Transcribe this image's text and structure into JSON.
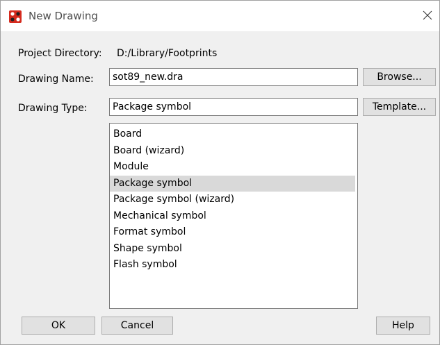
{
  "window": {
    "title": "New Drawing",
    "close_glyph": "✕",
    "icon": "cadence-app-icon"
  },
  "form": {
    "project_directory_label": "Project Directory:",
    "project_directory_value": "D:/Library/Footprints",
    "drawing_name_label": "Drawing Name:",
    "drawing_name_value": "sot89_new.dra",
    "drawing_type_label": "Drawing Type:",
    "drawing_type_value": "Package symbol"
  },
  "buttons": {
    "browse": "Browse...",
    "template": "Template...",
    "ok": "OK",
    "cancel": "Cancel",
    "help": "Help"
  },
  "drawing_types": [
    "Board",
    "Board (wizard)",
    "Module",
    "Package symbol",
    "Package symbol (wizard)",
    "Mechanical symbol",
    "Format symbol",
    "Shape symbol",
    "Flash symbol"
  ],
  "selected_type_index": 3,
  "colors": {
    "selection": "#d9d9d9",
    "icon_red": "#d52b1e"
  }
}
